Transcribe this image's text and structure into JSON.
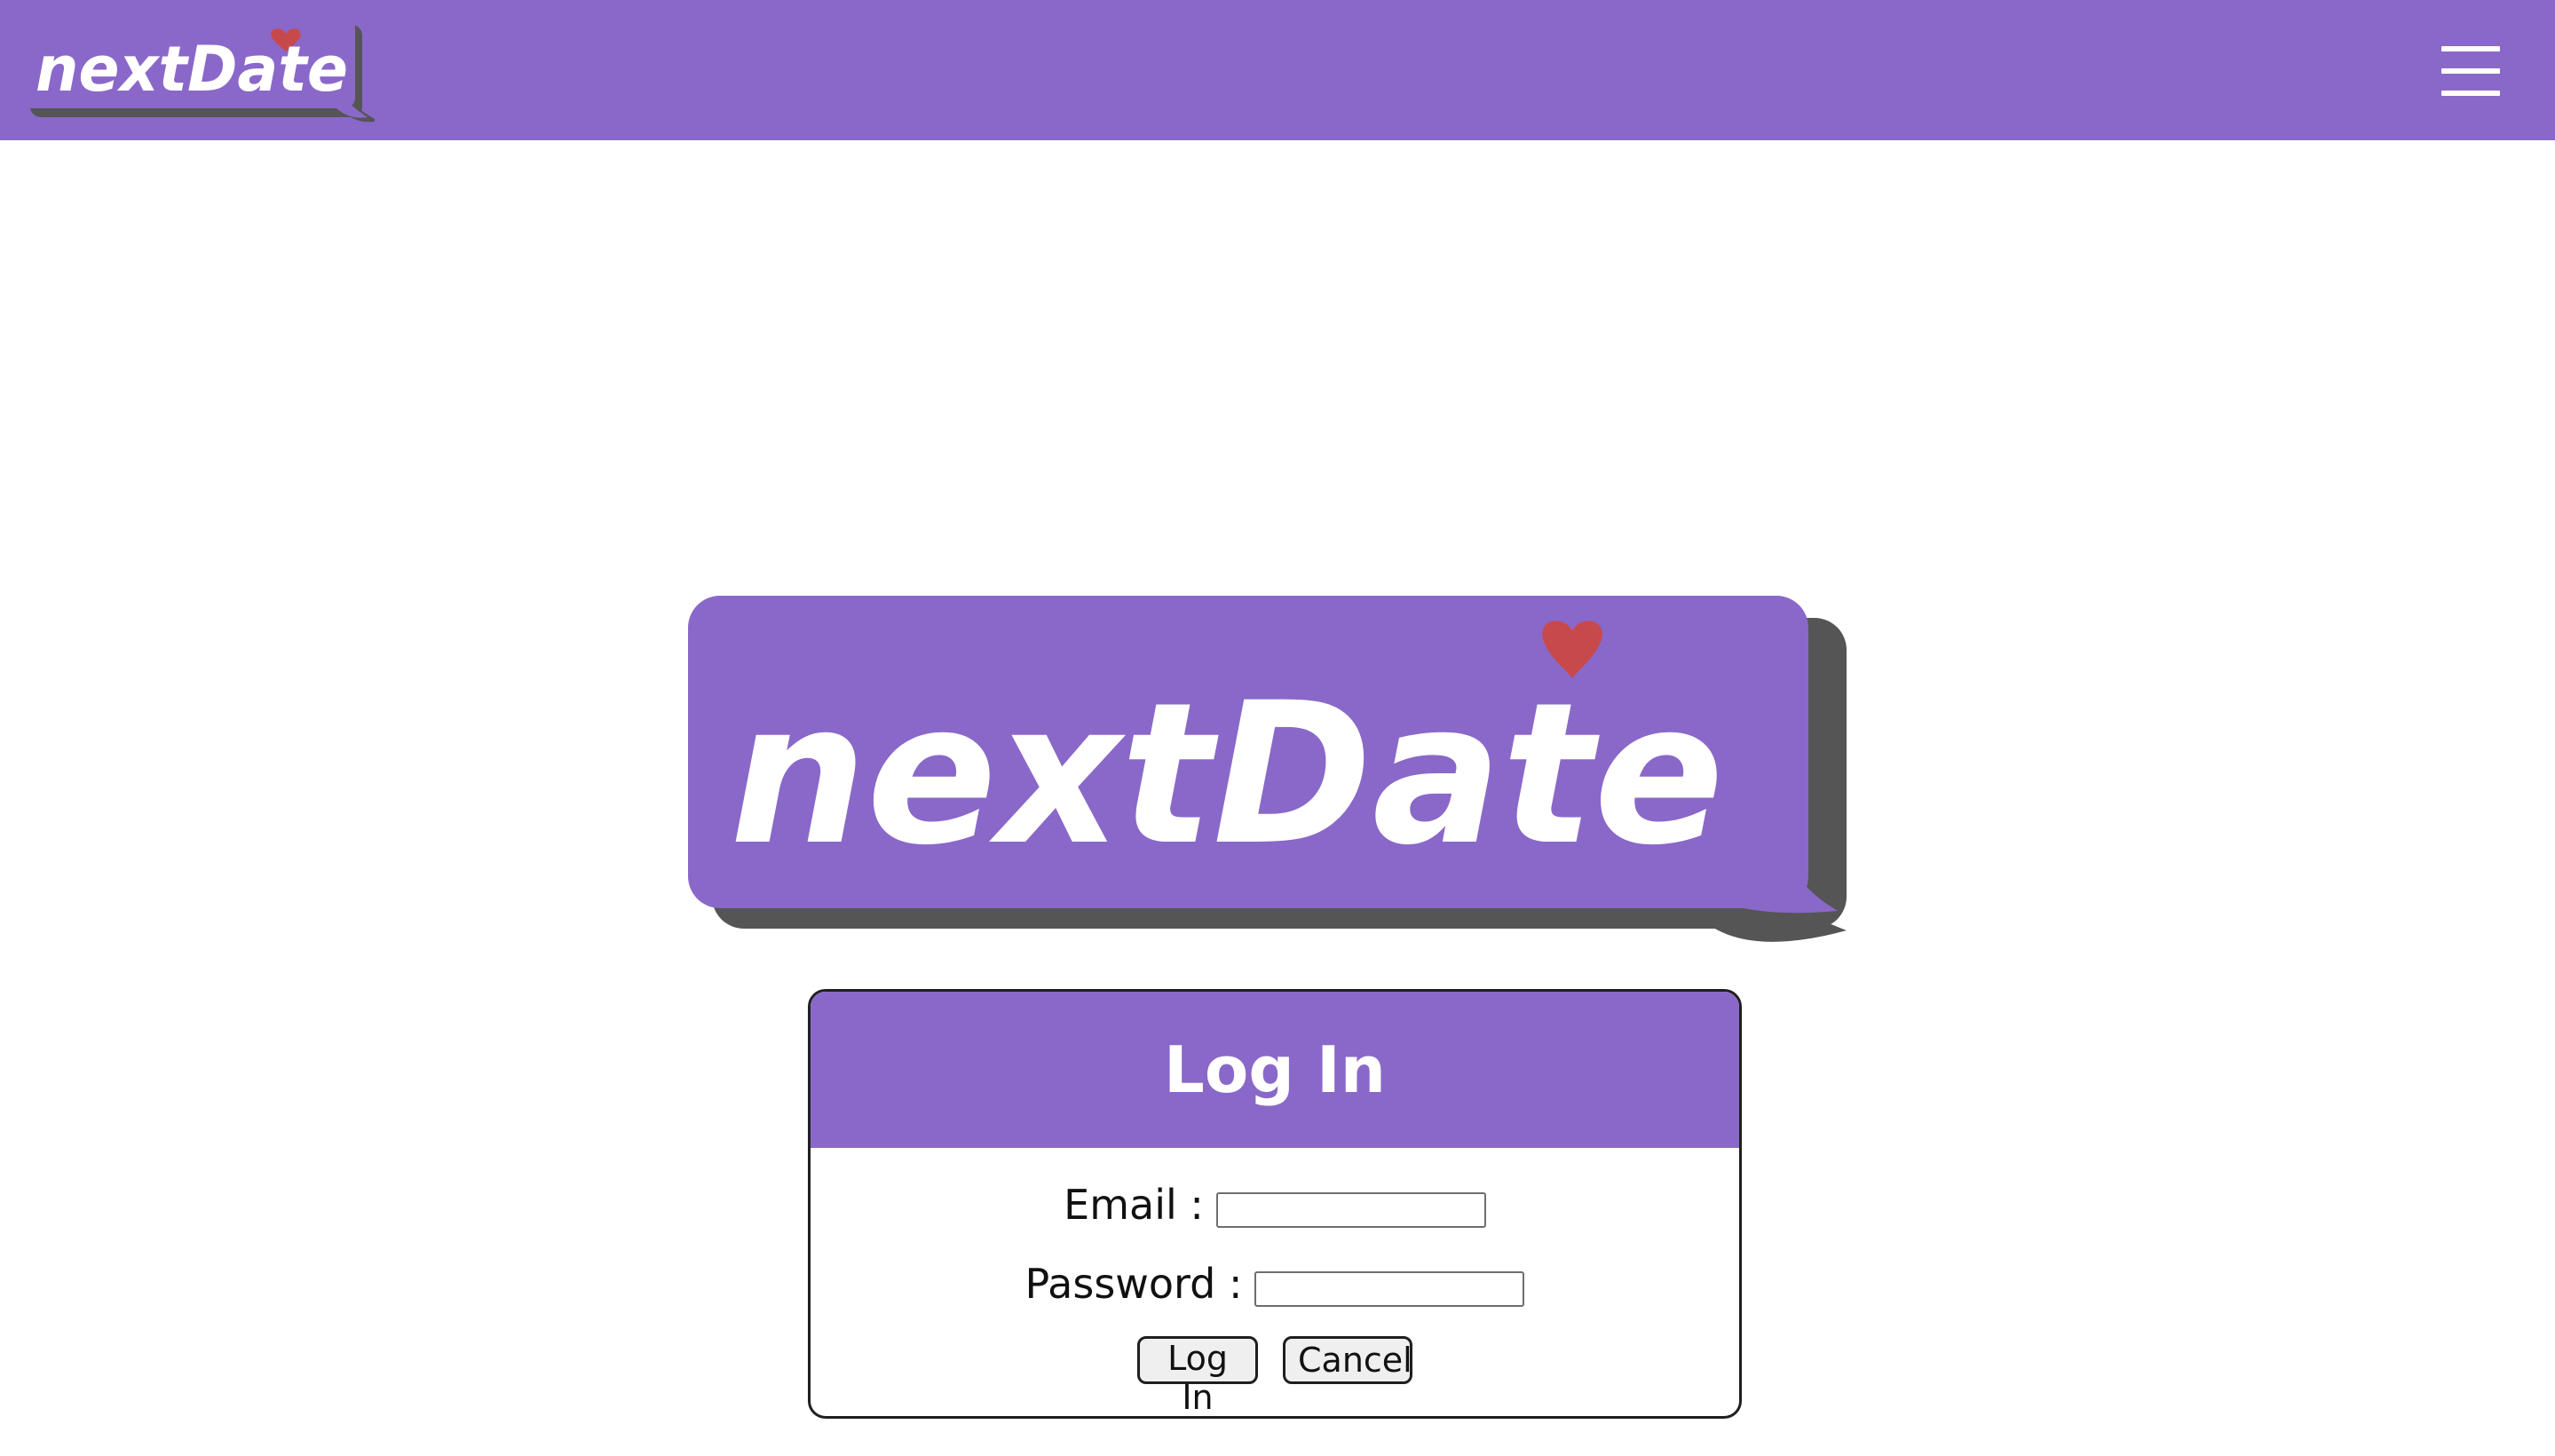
{
  "brand": {
    "name": "nextDate",
    "colors": {
      "primary": "#8a68c9",
      "shadow": "#555555",
      "heart": "#c8494b"
    }
  },
  "navbar": {
    "logo_text": "nextDate",
    "menu_icon": "hamburger-menu-icon"
  },
  "hero": {
    "logo_text": "nextDate"
  },
  "login": {
    "title": "Log In",
    "email_label": "Email :",
    "email_value": "",
    "password_label": "Password :",
    "password_value": "",
    "login_button": "Log In",
    "cancel_button": "Cancel"
  }
}
